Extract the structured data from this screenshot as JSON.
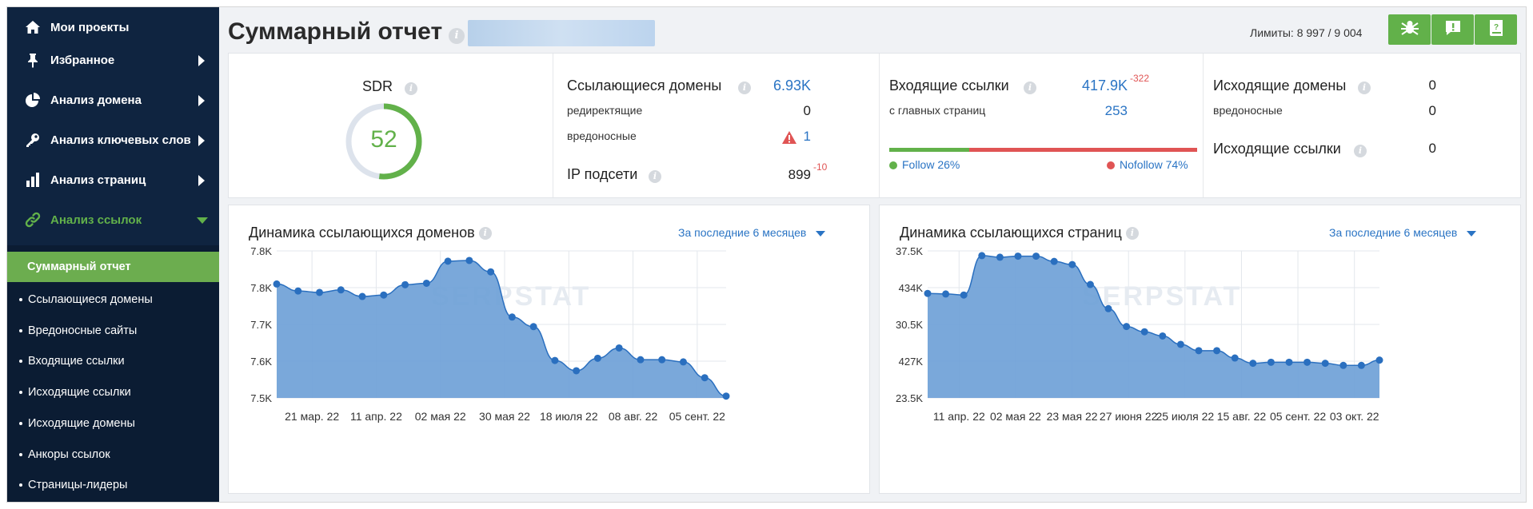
{
  "colors": {
    "sidebar_bg": "#0f2440",
    "accent_green": "#62b14a",
    "link_blue": "#2a74c4",
    "chart_fill": "#6fa1d7",
    "chart_line": "#2a6fbf",
    "negative_red": "#e05454"
  },
  "sidebar": {
    "items": [
      {
        "label": "Мои проекты",
        "icon": "home-icon"
      },
      {
        "label": "Избранное",
        "icon": "pin-icon"
      },
      {
        "label": "Анализ домена",
        "icon": "pie-chart-icon"
      },
      {
        "label": "Анализ ключевых слов",
        "icon": "key-icon"
      },
      {
        "label": "Анализ страниц",
        "icon": "bar-chart-icon"
      },
      {
        "label": "Анализ ссылок",
        "icon": "link-icon"
      }
    ],
    "subitems": [
      {
        "label": "Суммарный отчет"
      },
      {
        "label": "Ссылающиеся домены"
      },
      {
        "label": "Вредоносные сайты"
      },
      {
        "label": "Входящие ссылки"
      },
      {
        "label": "Исходящие ссылки"
      },
      {
        "label": "Исходящие домены"
      },
      {
        "label": "Анкоры ссылок"
      },
      {
        "label": "Страницы-лидеры"
      }
    ]
  },
  "header": {
    "title": "Суммарный отчет",
    "limits": "Лимиты: 8 997 / 9 004",
    "buttons": [
      "spider-icon",
      "feedback-icon",
      "help-book-icon"
    ]
  },
  "stats": {
    "sdr": {
      "label": "SDR",
      "value": "52",
      "fraction": 0.52
    },
    "ref_domains": {
      "label": "Ссылающиеся домены",
      "value": "6.93K",
      "redirect_label": "редиректящие",
      "redirect_value": "0",
      "malicious_label": "вредоносные",
      "malicious_value": "1"
    },
    "ip_subnets": {
      "label": "IP подсети",
      "value": "899",
      "delta": "-10"
    },
    "backlinks": {
      "label": "Входящие ссылки",
      "value": "417.9K",
      "delta": "-322",
      "main_pages_label": "с главных страниц",
      "main_pages_value": "253",
      "follow_label": "Follow 26%",
      "nofollow_label": "Nofollow 74%",
      "follow_share": 0.26
    },
    "outgoing_domains": {
      "label": "Исходящие домены",
      "value": "0",
      "malicious_label": "вредоносные",
      "malicious_value": "0"
    },
    "outgoing_links": {
      "label": "Исходящие ссылки",
      "value": "0"
    }
  },
  "chart_data": [
    {
      "type": "area",
      "title": "Динамика ссылающихся доменов",
      "period": "За последние 6 месяцев",
      "y_ticks": [
        "7.8K",
        "7.8K",
        "7.7K",
        "7.6K",
        "7.5K"
      ],
      "x_ticks": [
        "21 мар. 22",
        "11 апр. 22",
        "02 мая 22",
        "30 мая 22",
        "18 июля 22",
        "08 авг. 22",
        "05 сент. 22"
      ],
      "ylim": [
        7500,
        7900
      ],
      "values": [
        7810,
        7791,
        7787,
        7794,
        7776,
        7780,
        7808,
        7812,
        7872,
        7874,
        7843,
        7720,
        7694,
        7602,
        7574,
        7608,
        7636,
        7604,
        7604,
        7598,
        7555,
        7505
      ],
      "watermark": "SERPSTAT"
    },
    {
      "type": "area",
      "title": "Динамика ссылающихся страниц",
      "period": "За последние 6 месяцев",
      "y_ticks": [
        "37.5K",
        "434K",
        "30.5K",
        "427K",
        "23.5K"
      ],
      "x_ticks": [
        "11 апр. 22",
        "02 мая 22",
        "23 мая 22",
        "27 июня 22",
        "25 июля 22",
        "15 авг. 22",
        "05 сент. 22",
        "03 окт. 22"
      ],
      "ylim": [
        423500,
        437500
      ],
      "values": [
        433450,
        433400,
        433300,
        437050,
        436900,
        437000,
        437000,
        436500,
        436200,
        434300,
        432000,
        430300,
        429800,
        429400,
        428600,
        428000,
        428000,
        427300,
        426800,
        426900,
        426900,
        426900,
        426800,
        426600,
        426600,
        427100
      ],
      "watermark": "SERPSTAT"
    }
  ]
}
